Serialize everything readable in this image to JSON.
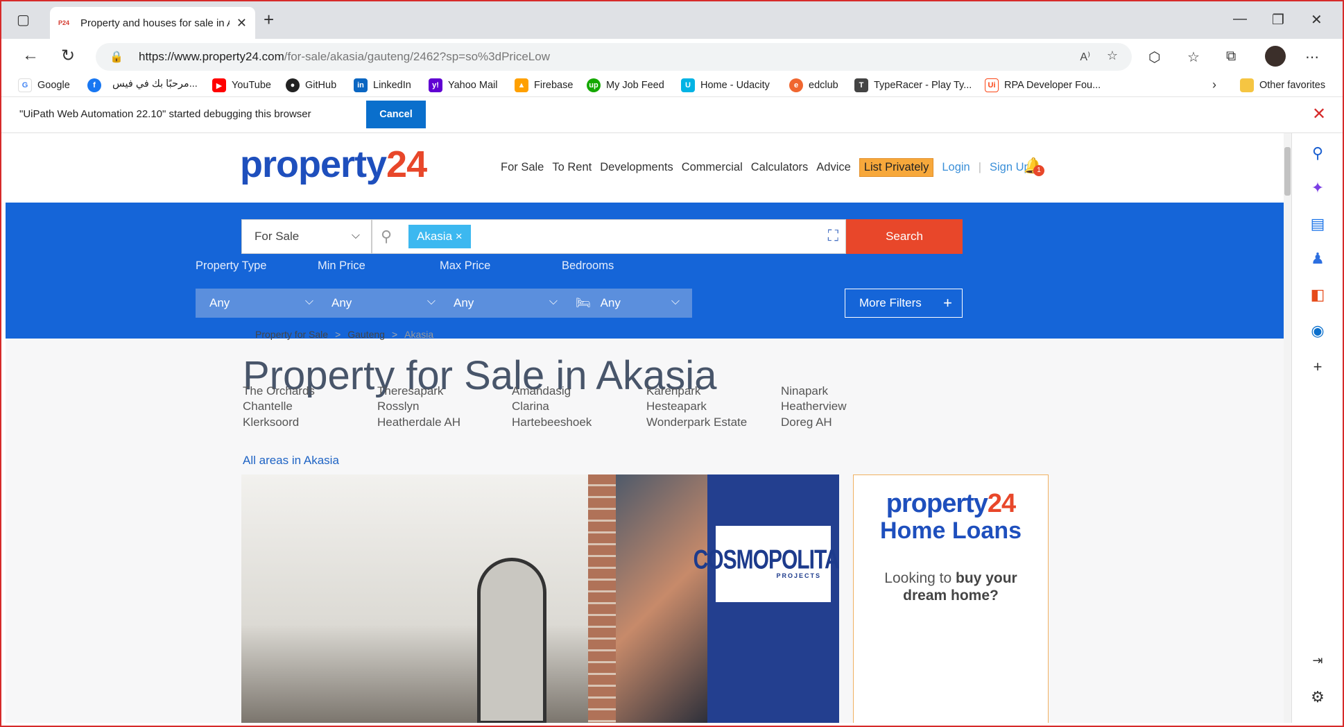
{
  "browser": {
    "tab_title": "Property and houses for sale in A",
    "tab_favicon": "P24",
    "url_domain": "https://www.property24.com",
    "url_path": "/for-sale/akasia/gauteng/2462?sp=so%3dPriceLow",
    "new_tab": "+",
    "minimize": "—",
    "restore": "❐",
    "close": "✕"
  },
  "bookmarks": [
    {
      "label": "Google",
      "icon": "google-icon",
      "color": "#4285f4"
    },
    {
      "label": "",
      "icon": "facebook-icon",
      "color": "#1877f2"
    },
    {
      "label": "مرحبًا بك في فيس...",
      "icon": "",
      "color": ""
    },
    {
      "label": "YouTube",
      "icon": "youtube-icon",
      "color": "#ff0000"
    },
    {
      "label": "GitHub",
      "icon": "github-icon",
      "color": "#222222"
    },
    {
      "label": "LinkedIn",
      "icon": "linkedin-icon",
      "color": "#0a66c2"
    },
    {
      "label": "Yahoo Mail",
      "icon": "yahoo-icon",
      "color": "#6001d2"
    },
    {
      "label": "Firebase",
      "icon": "firebase-icon",
      "color": "#ffa000"
    },
    {
      "label": "My Job Feed",
      "icon": "upwork-icon",
      "color": "#14a800"
    },
    {
      "label": "Home - Udacity",
      "icon": "udacity-icon",
      "color": "#02b3e4"
    },
    {
      "label": "edclub",
      "icon": "edclub-icon",
      "color": "#f0662f"
    },
    {
      "label": "TypeRacer - Play Ty...",
      "icon": "typeracer-icon",
      "color": "#444444"
    },
    {
      "label": "RPA Developer Fou...",
      "icon": "uipath-icon",
      "color": "#fa4616"
    }
  ],
  "bookmarks_other": "Other favorites",
  "infobar": {
    "message": "\"UiPath Web Automation 22.10\" started debugging this browser",
    "cancel_label": "Cancel"
  },
  "site": {
    "logo_main": "property",
    "logo_num": "24",
    "nav": [
      "For Sale",
      "To Rent",
      "Developments",
      "Commercial",
      "Calculators",
      "Advice"
    ],
    "list_privately": "List Privately",
    "login": "Login",
    "signup": "Sign Up",
    "notification_count": "1",
    "colors": {
      "brand_blue": "#1565d8",
      "accent_red": "#e8472a",
      "chip": "#3cb8f0",
      "private_orange": "#f7a83b"
    }
  },
  "search": {
    "listing_type": "For Sale",
    "location_chip": "Akasia",
    "chip_remove": "×",
    "button": "Search",
    "filters": [
      {
        "label": "Property Type",
        "value": "Any"
      },
      {
        "label": "Min Price",
        "value": "Any"
      },
      {
        "label": "Max Price",
        "value": "Any"
      },
      {
        "label": "Bedrooms",
        "value": "Any"
      }
    ],
    "more_filters": "More Filters"
  },
  "main": {
    "title": "Property for Sale in Akasia",
    "breadcrumbs": [
      "Property for Sale",
      "Gauteng",
      "Akasia"
    ],
    "areas": [
      [
        "The Orchards",
        "Chantelle",
        "Klerksoord"
      ],
      [
        "Theresapark",
        "Rosslyn",
        "Heatherdale AH"
      ],
      [
        "Amandasig",
        "Clarina",
        "Hartebeeshoek"
      ],
      [
        "Karenpark",
        "Hesteapark",
        "Wonderpark Estate"
      ],
      [
        "Ninapark",
        "Heatherview",
        "Doreg AH"
      ]
    ],
    "all_areas": "All areas in Akasia"
  },
  "promo": {
    "brand": "COSMOPOLITAN",
    "brand_sub": "PROJECTS"
  },
  "ad": {
    "logo_main": "property",
    "logo_num": "24",
    "headline": "Home Loans",
    "copy_1": "Looking to ",
    "copy_bold": "buy your",
    "copy_2": "dream home?"
  }
}
